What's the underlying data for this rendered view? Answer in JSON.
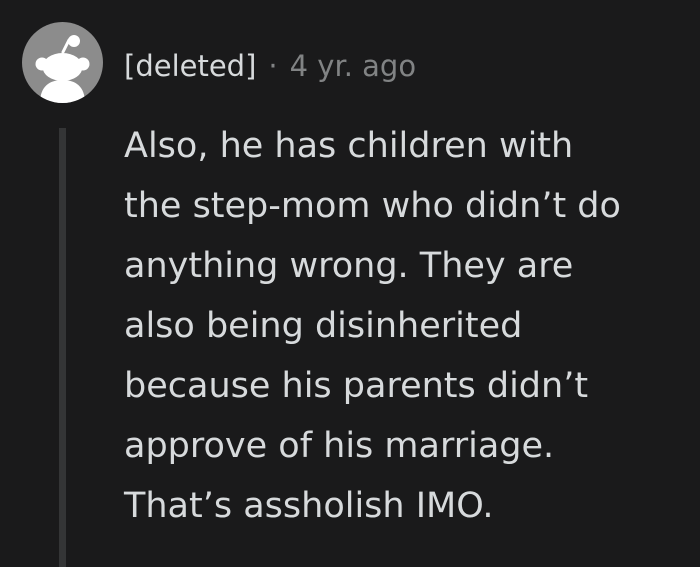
{
  "comment": {
    "author": "[deleted]",
    "separator": "·",
    "timestamp": "4 yr. ago",
    "body_lines": [
      "Also, he has children with",
      "the step-mom who didn’t do",
      "anything wrong. They are",
      "also being disinherited",
      "because his parents didn’t",
      "approve of his marriage.",
      "That’s assholish IMO."
    ]
  },
  "colors": {
    "background": "#1a1a1b",
    "text": "#d7dadc",
    "meta": "#818384",
    "avatar_bg": "#8c8c8c",
    "thread_line": "#343536"
  },
  "icons": {
    "avatar": "reddit-snoo-icon"
  }
}
